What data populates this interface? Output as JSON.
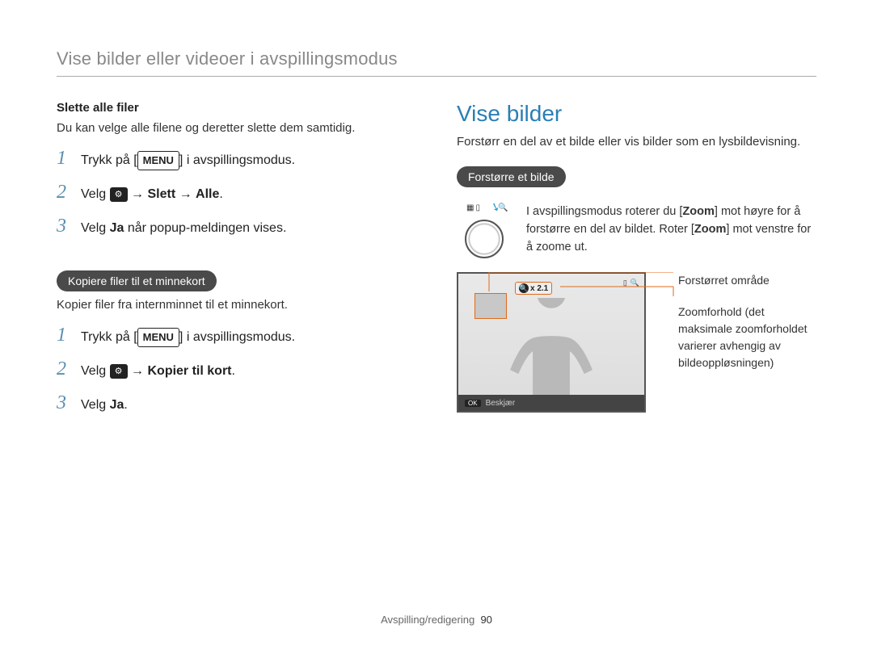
{
  "header": "Vise bilder eller videoer i avspillingsmodus",
  "left": {
    "deleteAll": {
      "heading": "Slette alle filer",
      "desc": "Du kan velge alle filene og deretter slette dem samtidig.",
      "steps": {
        "s1a": "Trykk på [",
        "s1menu": "MENU",
        "s1b": "] i avspillingsmodus.",
        "s2a": "Velg ",
        "s2arrow1": " → ",
        "s2bold1": "Slett",
        "s2arrow2": " → ",
        "s2bold2": "Alle",
        "s2dot": ".",
        "s3a": "Velg ",
        "s3bold": "Ja",
        "s3b": " når popup-meldingen vises."
      }
    },
    "copy": {
      "pill": "Kopiere filer til et minnekort",
      "desc": "Kopier filer fra internminnet til et minnekort.",
      "steps": {
        "s1a": "Trykk på [",
        "s1menu": "MENU",
        "s1b": "] i avspillingsmodus.",
        "s2a": "Velg ",
        "s2arrow": " → ",
        "s2bold": "Kopier til kort",
        "s2dot": ".",
        "s3a": "Velg ",
        "s3bold": "Ja",
        "s3dot": "."
      }
    }
  },
  "right": {
    "title": "Vise bilder",
    "desc": "Forstørr en del av et bilde eller vis bilder som en lysbildevisning.",
    "pill": "Forstørre et bilde",
    "zoomText": {
      "a": "I avspillingsmodus roterer du [",
      "zoom1": "Zoom",
      "b": "] mot høyre for å forstørre en del av bildet. Roter [",
      "zoom2": "Zoom",
      "c": "] mot venstre for å zoome ut."
    },
    "zoomBadge": "x 2.1",
    "bottomBar": {
      "ok": "OK",
      "label": "Beskjær"
    },
    "callouts": {
      "c1": "Forstørret område",
      "c2": "Zoomforhold (det maksimale zoomforholdet varierer avhengig av bildeoppløsningen)"
    }
  },
  "footer": {
    "section": "Avspilling/redigering",
    "page": "90"
  }
}
